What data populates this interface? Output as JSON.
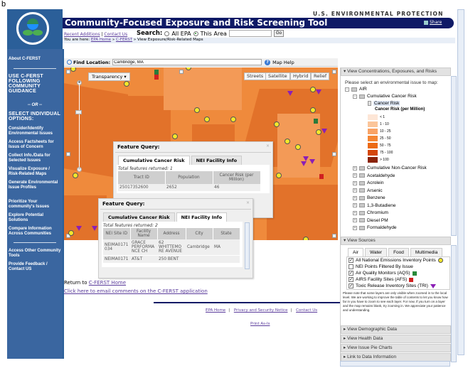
{
  "figure_label": "b",
  "header": {
    "agency": "U.S. ENVIRONMENTAL PROTECTION AGENCY",
    "title": "Community-Focused Exposure and Risk Screening Tool",
    "share": "Share",
    "links": [
      "Recent Additions",
      "Contact Us"
    ],
    "link_sep": "|",
    "search_label": "Search:",
    "search_options": [
      "All EPA",
      "This Area"
    ],
    "search_selected": "This Area",
    "search_value": "",
    "go_label": "Go",
    "breadcrumb_prefix": "You are here:",
    "breadcrumb": [
      "EPA Home",
      "C-FERST",
      "View Exposure/Risk-Related Maps"
    ]
  },
  "sidebar": {
    "items": [
      "About C-FERST",
      "USE C-FERST FOLLOWING COMMUNITY GUIDANCE",
      "-- OR --",
      "SELECT INDIVIDUAL OPTIONS:",
      "Consider/Identify Environmental Issues",
      "Access Factsheets for Issus of Concern",
      "Collect Info./Data for Selected Issues",
      "Visualize Exposure / Risk-Related Maps",
      "Generate Environmental Issue Profiles",
      "Prioritize Your community's Issues",
      "Explore Potential Solutions",
      "Compare Information Across Communities",
      "Access Other Community Tools",
      "Provide Feedback / Contact US"
    ]
  },
  "find": {
    "label": "Find Location:",
    "value": "Cambridge, MA",
    "help": "Map Help"
  },
  "map": {
    "transparency": "Transparency",
    "buttons": [
      "Streets",
      "Satellite",
      "Hybrid",
      "Relief"
    ]
  },
  "popup1": {
    "title": "Feature Query:",
    "close": "×",
    "tabs": [
      "Cumulative Cancer Risk",
      "NEI Facility Info"
    ],
    "active_tab": "Cumulative Cancer Risk",
    "total": "Total features returned: 1",
    "columns": [
      "Tract ID",
      "Population",
      "Cancer Risk (per Million)"
    ],
    "rows": [
      [
        "25017352600",
        "2652",
        "46"
      ]
    ]
  },
  "popup2": {
    "title": "Feature Query:",
    "close": "×",
    "tabs": [
      "Cumulative Cancer Risk",
      "NEI Facility Info"
    ],
    "active_tab": "NEI Facility Info",
    "total": "Total features returned: 2",
    "columns": [
      "NEI Site ID",
      "Facility Name",
      "Address",
      "City",
      "State"
    ],
    "rows": [
      [
        "NEIMA0171 034",
        "GRACE PERFORMA NCE CH",
        "62 WHITTEMO RE AVENUE",
        "Cambridge",
        "MA"
      ],
      [
        "NEIMA0171",
        "AT&T",
        "250 BENT",
        "",
        ""
      ]
    ]
  },
  "body_links": {
    "return_prefix": "Return to",
    "return_link": "C-FERST Home",
    "email": "Click here to email comments on the C-FERST application"
  },
  "footer": {
    "links": [
      "EPA Home",
      "Privacy and Security Notice",
      "Contact Us"
    ],
    "print": "Print As-Is"
  },
  "right_panel": {
    "concentrations_header": "View Concentrations, Exposures, and Risks",
    "prompt": "Please select an environmental issue to map:",
    "tree": {
      "root": "AIR",
      "group": "Cumulative Cancer Risk",
      "selected_leaf": "Cancer Risk",
      "legend_title": "Cancer Risk (per Million)",
      "legend": [
        {
          "label": "< 1",
          "color": "#fde6d6"
        },
        {
          "label": "1 - 10",
          "color": "#fbc59a"
        },
        {
          "label": "10 - 25",
          "color": "#f9a366"
        },
        {
          "label": "25 - 50",
          "color": "#f58634"
        },
        {
          "label": "50 - 75",
          "color": "#ec6a14"
        },
        {
          "label": "75 - 100",
          "color": "#d4470a"
        },
        {
          "label": "> 100",
          "color": "#8a2308"
        }
      ],
      "items": [
        "Cumulative Non-Cancer Risk",
        "Acetaldehyde",
        "Acrolein",
        "Arsenic",
        "Benzene",
        "1,3-Butadiene",
        "Chromium",
        "Diesel PM",
        "Formaldehyde"
      ]
    },
    "sources_header": "View Sources",
    "source_tabs": [
      "Air",
      "Water",
      "Food",
      "Multimedia"
    ],
    "active_source_tab": "Air",
    "source_layers": [
      {
        "label": "All National Emissions Inventory Points",
        "checked": true,
        "icon": "yellow-dot"
      },
      {
        "label": "NEI Points Filtered By Issue",
        "checked": false,
        "icon": ""
      },
      {
        "label": "Air Quality Monitors (AQS)",
        "checked": true,
        "icon": "green-marker"
      },
      {
        "label": "AIRS Facility Sites (AFS)",
        "checked": true,
        "icon": "red-marker"
      },
      {
        "label": "Toxic Release Inventory Sites (TRI)",
        "checked": true,
        "icon": "purple-triangle"
      }
    ],
    "note": "Please note that some layers are only visible when zoomed in to the local level. We are working to improve the table of contents to let you know how far in you have to zoom to see each layer. For now, if you turn on a layer and the map remains blank, try zooming in. We appreciate your patience and understanding.",
    "collapsed_headers": [
      "View Demographic Data",
      "View Health Data",
      "View Issue Pie Charts",
      "Link to Data Information"
    ]
  }
}
